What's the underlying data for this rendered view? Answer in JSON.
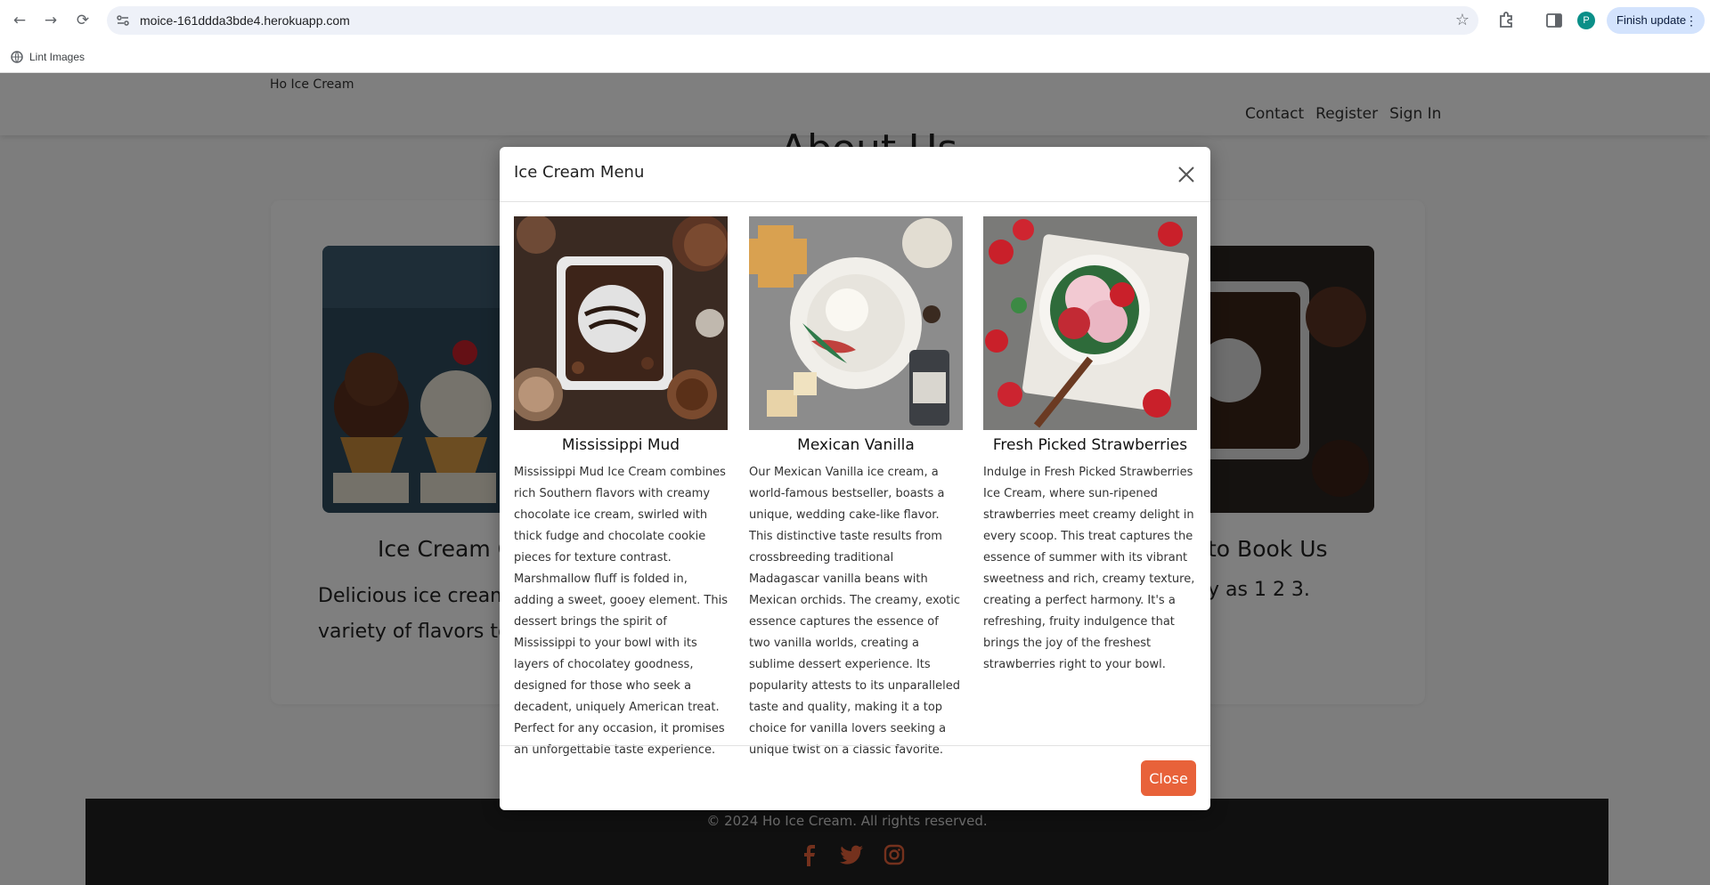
{
  "browser": {
    "url": "moice-161ddda3bde4.herokuapp.com",
    "bookmark_label": "Lint Images",
    "profile_initial": "P",
    "update_label": "Finish update"
  },
  "site": {
    "brand": "Ho Ice Cream",
    "nav": [
      "Contact",
      "Register",
      "Sign In"
    ],
    "about_title": "About Us",
    "section1_title": "Ice Cream Co",
    "section1_text": "Delicious ice cream co variety of flavors to ch",
    "section2_title": "to Book Us",
    "section2_text": "y as 1 2 3.",
    "footer_text": "© 2024 Ho Ice Cream. All rights reserved."
  },
  "modal": {
    "title": "Ice Cream Menu",
    "close_label": "Close",
    "items": [
      {
        "name": "Mississippi Mud",
        "description": "Mississippi Mud Ice Cream combines rich Southern flavors with creamy chocolate ice cream, swirled with thick fudge and chocolate cookie pieces for texture contrast. Marshmallow fluff is folded in, adding a sweet, gooey element. This dessert brings the spirit of Mississippi to your bowl with its layers of chocolatey goodness, designed for those who seek a decadent, uniquely American treat. Perfect for any occasion, it promises an unforgettable taste experience."
      },
      {
        "name": "Mexican Vanilla",
        "description": "Our Mexican Vanilla ice cream, a world-famous bestseller, boasts a unique, wedding cake-like flavor. This distinctive taste results from crossbreeding traditional Madagascar vanilla beans with Mexican orchids. The creamy, exotic essence captures the essence of two vanilla worlds, creating a sublime dessert experience. Its popularity attests to its unparalleled taste and quality, making it a top choice for vanilla lovers seeking a unique twist on a classic favorite."
      },
      {
        "name": "Fresh Picked Strawberries",
        "description": "Indulge in Fresh Picked Strawberries Ice Cream, where sun-ripened strawberries meet creamy delight in every scoop. This treat captures the essence of summer with its vibrant sweetness and rich, creamy texture, creating a perfect harmony. It's a refreshing, fruity indulgence that brings the joy of the freshest strawberries right to your bowl."
      }
    ]
  },
  "colors": {
    "accent": "#e8623a",
    "footer_bg": "#212121",
    "social_icon": "#e8623a"
  }
}
